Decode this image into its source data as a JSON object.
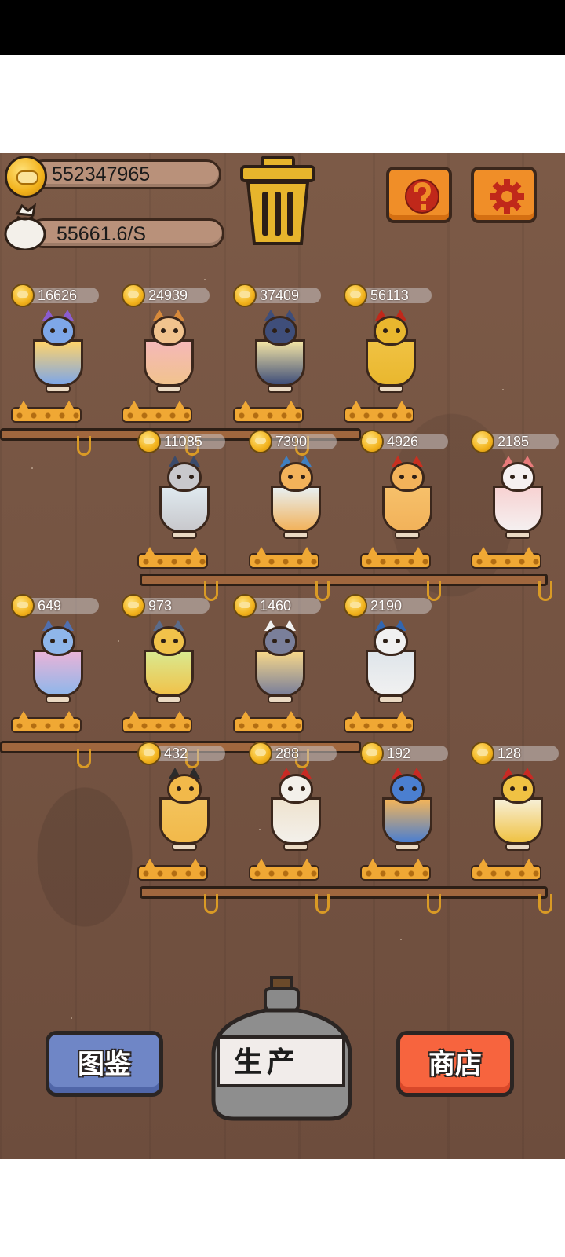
{
  "resources": {
    "coins": "552347965",
    "income": "55661.6/S"
  },
  "icons": {
    "coin": "coin-icon",
    "bag": "money-bag-icon",
    "trash": "trash-can-icon",
    "help": "question-icon",
    "settings": "gear-icon"
  },
  "colors": {
    "wood": "#6f4f3e",
    "orange_button": "#f08e28",
    "atlas_button": "#6f86c6",
    "shop_button": "#f7643e"
  },
  "slots": [
    {
      "price": "16626",
      "cat": "wizard-cat-beer-mug"
    },
    {
      "price": "24939",
      "cat": "llama-cat-smoothie"
    },
    {
      "price": "37409",
      "cat": "black-cat-grapes-glass"
    },
    {
      "price": "56113",
      "cat": "yellow-cat-teapot"
    },
    {
      "price": "11085",
      "cat": "detective-cat-bowl"
    },
    {
      "price": "7390",
      "cat": "blue-cape-cat-cup"
    },
    {
      "price": "4926",
      "cat": "red-hat-cat-glass"
    },
    {
      "price": "2185",
      "cat": "white-cat-sundae"
    },
    {
      "price": "649",
      "cat": "blue-cat-wine-glass"
    },
    {
      "price": "973",
      "cat": "sunflower-cat-glass"
    },
    {
      "price": "1460",
      "cat": "twin-cats-beer"
    },
    {
      "price": "2190",
      "cat": "blue-robe-cat-bowl"
    },
    {
      "price": "432",
      "cat": "sunglasses-cat-glass"
    },
    {
      "price": "288",
      "cat": "red-jacket-cat-bowl"
    },
    {
      "price": "192",
      "cat": "blue-cat-pitcher"
    },
    {
      "price": "128",
      "cat": "golden-armor-cat-cup"
    }
  ],
  "menu": {
    "atlas": "图鉴",
    "produce": "生产",
    "shop": "商店"
  }
}
